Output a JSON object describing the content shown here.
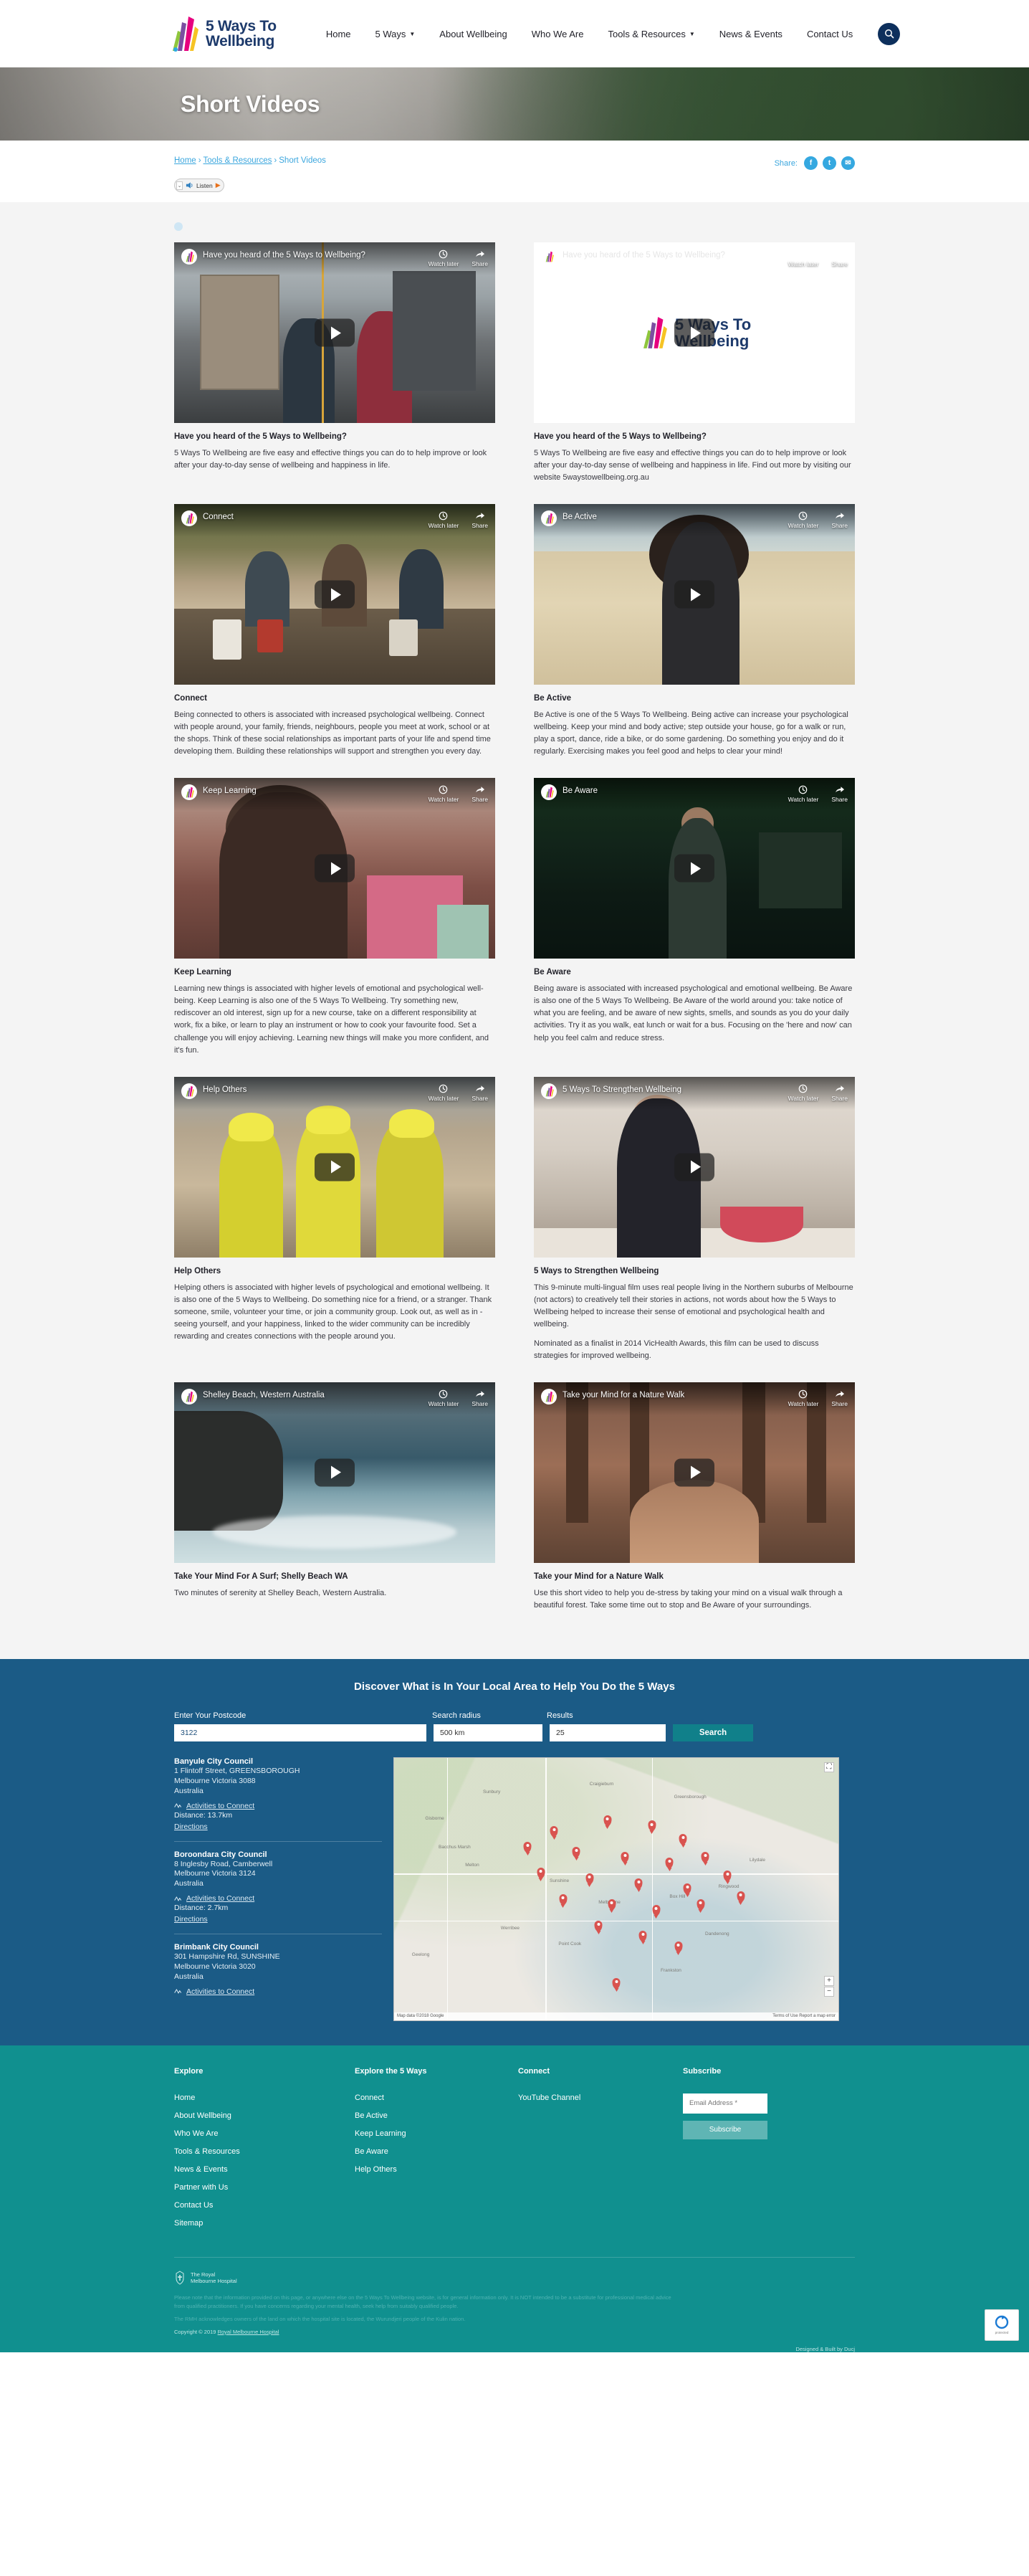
{
  "site": {
    "logo_line1": "5 Ways To",
    "logo_line2": "Wellbeing"
  },
  "nav": {
    "items": [
      {
        "label": "Home",
        "has_dropdown": false
      },
      {
        "label": "5 Ways",
        "has_dropdown": true
      },
      {
        "label": "About Wellbeing",
        "has_dropdown": false
      },
      {
        "label": "Who We Are",
        "has_dropdown": false
      },
      {
        "label": "Tools & Resources",
        "has_dropdown": true
      },
      {
        "label": "News & Events",
        "has_dropdown": false
      },
      {
        "label": "Contact Us",
        "has_dropdown": false
      }
    ],
    "search_icon": "search-icon"
  },
  "hero": {
    "title": "Short Videos"
  },
  "breadcrumb": {
    "items": [
      "Home",
      "Tools & Resources",
      "Short Videos"
    ],
    "separator": "›"
  },
  "share": {
    "label": "Share:",
    "icons": [
      {
        "name": "facebook-icon",
        "glyph": "f"
      },
      {
        "name": "twitter-icon",
        "glyph": "t"
      },
      {
        "name": "email-icon",
        "glyph": "✉"
      }
    ]
  },
  "listen_widget": {
    "label": "Listen",
    "play_glyph": "▶",
    "chevron": "⌄"
  },
  "videos": [
    {
      "overlay_title": "Have you heard of the 5 Ways to Wellbeing?",
      "watch_later": "Watch later",
      "share": "Share",
      "title": "Have you heard of the 5 Ways to Wellbeing?",
      "paragraphs": [
        "5 Ways To Wellbeing are five easy and effective things you can do to help improve or look after your day-to-day sense of wellbeing and happiness in life."
      ],
      "scene": "s-tram",
      "bar_style": "dark"
    },
    {
      "overlay_title": "Have you heard of the 5 Ways to Wellbeing?",
      "watch_later": "Watch later",
      "share": "Share",
      "title": "Have you heard of the 5 Ways to Wellbeing?",
      "paragraphs": [
        "5 Ways To Wellbeing are five easy and effective things you can do to help improve or look after your day-to-day sense of wellbeing and happiness in life. Find out more by visiting our website 5waystowellbeing.org.au"
      ],
      "scene": "s-white",
      "bar_style": "light"
    },
    {
      "overlay_title": "Connect",
      "watch_later": "Watch later",
      "share": "Share",
      "title": "Connect",
      "paragraphs": [
        "Being connected to others is associated with increased psychological wellbeing. Connect with people around, your family, friends, neighbours, people you meet at work, school or at the shops. Think of these social relationships as important parts of your life and spend time developing them. Building these relationships will support and strengthen you every day."
      ],
      "scene": "s-table",
      "bar_style": "dark"
    },
    {
      "overlay_title": "Be Active",
      "watch_later": "Watch later",
      "share": "Share",
      "title": "Be Active",
      "paragraphs": [
        "Be Active is one of the 5 Ways To Wellbeing. Being active can increase your psychological wellbeing. Keep your mind and body active; step outside your house, go for a walk or run, play a sport, dance, ride a bike, or do some gardening. Do something you enjoy and do it regularly. Exercising makes you feel good and helps to clear your mind!"
      ],
      "scene": "s-beach",
      "bar_style": "dark"
    },
    {
      "overlay_title": "Keep Learning",
      "watch_later": "Watch later",
      "share": "Share",
      "title": "Keep Learning",
      "paragraphs": [
        "Learning new things is associated with higher levels of emotional and psychological well-being. Keep Learning is also one of the 5 Ways To Wellbeing. Try something new, rediscover an old interest, sign up for a new course, take on a different responsibility at work, fix a bike, or learn to play an instrument or how to cook your favourite food. Set a challenge you will enjoy achieving. Learning new things will make you more confident, and it's fun."
      ],
      "scene": "s-kitchen",
      "bar_style": "dark"
    },
    {
      "overlay_title": "Be Aware",
      "watch_later": "Watch later",
      "share": "Share",
      "title": "Be Aware",
      "paragraphs": [
        "Being aware is associated with increased psychological and emotional wellbeing. Be Aware is also one of the 5 Ways To Wellbeing. Be Aware of the world around you: take notice of what you are feeling, and be aware of new sights, smells, and sounds as you do your daily activities. Try it as you walk, eat lunch or wait for a bus. Focusing on the 'here and now' can help you feel calm and reduce stress."
      ],
      "scene": "s-night",
      "bar_style": "dark"
    },
    {
      "overlay_title": "Help Others",
      "watch_later": "Watch later",
      "share": "Share",
      "title": "Help Others",
      "paragraphs": [
        "Helping others is associated with higher levels of psychological and emotional wellbeing. It is also one of the 5 Ways to Wellbeing. Do something nice for a friend, or a stranger. Thank someone, smile, volunteer your time, or join a community group. Look out, as well as in - seeing yourself, and your happiness, linked to the wider community can be incredibly rewarding and creates connections with the people around you."
      ],
      "scene": "s-site",
      "bar_style": "dark"
    },
    {
      "overlay_title": "5 Ways To Strengthen Wellbeing",
      "watch_later": "Watch later",
      "share": "Share",
      "title": "5 Ways to Strengthen Wellbeing",
      "paragraphs": [
        "This 9-minute multi-lingual film uses real people living in the Northern suburbs of Melbourne (not actors) to creatively tell their stories in actions, not words about how the 5 Ways to Wellbeing helped to increase their sense of emotional and psychological health and wellbeing.",
        "Nominated as a finalist in 2014 VicHealth Awards, this film can be used to discuss strategies for improved wellbeing."
      ],
      "scene": "s-cook",
      "bar_style": "dark"
    },
    {
      "overlay_title": "Shelley Beach, Western Australia",
      "watch_later": "Watch later",
      "share": "Share",
      "title": "Take Your Mind For A Surf; Shelly Beach WA",
      "paragraphs": [
        "Two minutes of serenity at Shelley Beach, Western Australia."
      ],
      "scene": "s-ocean",
      "bar_style": "dark"
    },
    {
      "overlay_title": "Take your Mind for a Nature Walk",
      "watch_later": "Watch later",
      "share": "Share",
      "title": "Take your Mind for a Nature Walk",
      "paragraphs": [
        "Use this short video to help you de-stress by taking your mind on a visual walk through a beautiful forest. Take some time out to stop and Be Aware of your surroundings."
      ],
      "scene": "s-forest",
      "bar_style": "dark"
    }
  ],
  "locator": {
    "heading": "Discover What is In Your Local Area to Help You Do the 5 Ways",
    "label_postcode": "Enter Your Postcode",
    "label_radius": "Search radius",
    "label_results": "Results",
    "postcode_value": "3122",
    "radius_value": "500 km",
    "results_value": "25",
    "search_button": "Search",
    "results_list": [
      {
        "name": "Banyule City Council",
        "address1": "1 Flintoff Street, GREENSBOROUGH",
        "address2": "Melbourne Victoria 3088",
        "address3": "Australia",
        "activities_link": "Activities to Connect",
        "distance": "Distance: 13.7km",
        "directions": "Directions"
      },
      {
        "name": "Boroondara City Council",
        "address1": "8 Inglesby Road, Camberwell",
        "address2": "Melbourne Victoria 3124",
        "address3": "Australia",
        "activities_link": "Activities to Connect",
        "distance": "Distance: 2.7km",
        "directions": "Directions"
      },
      {
        "name": "Brimbank City Council",
        "address1": "301 Hampshire Rd, SUNSHINE",
        "address2": "Melbourne Victoria 3020",
        "address3": "Australia",
        "activities_link": "Activities to Connect",
        "distance": "",
        "directions": ""
      }
    ],
    "map": {
      "labels": [
        "Sunbury",
        "Gisborne",
        "Craigieburn",
        "Greensborough",
        "Melton",
        "Sunshine",
        "Melbourne",
        "Ringwood",
        "Box Hill",
        "Werribee",
        "Point Cook",
        "Frankston",
        "Dandenong",
        "Geelong",
        "Bacchus Marsh",
        "Lilydale"
      ],
      "attribution_left": "Map data ©2018 Google",
      "attribution_right": "Terms of Use   Report a map error",
      "zoom_in": "+",
      "zoom_out": "−",
      "fullscreen": "⛶"
    }
  },
  "footer": {
    "columns": [
      {
        "heading": "Explore",
        "links": [
          "Home",
          "About Wellbeing",
          "Who We Are",
          "Tools & Resources",
          "News & Events",
          "Partner with Us",
          "Contact Us",
          "Sitemap"
        ]
      },
      {
        "heading": "Explore the 5 Ways",
        "links": [
          "Connect",
          "Be Active",
          "Keep Learning",
          "Be Aware",
          "Help Others"
        ]
      },
      {
        "heading": "Connect",
        "links": [
          "YouTube Channel"
        ]
      }
    ],
    "subscribe": {
      "heading": "Subscribe",
      "placeholder": "Email Address *",
      "button": "Subscribe"
    },
    "rmh_line1": "The Royal",
    "rmh_line2": "Melbourne Hospital",
    "disclaimer": [
      "Please note that the information provided on this page, or anywhere else on the 5 Ways To Wellbeing website, is for general information only. It is NOT intended to be a substitute for professional medical advice from qualified practitioners. If you have concerns regarding your mental health, seek help from suitably qualified people.",
      "The RMH acknowledges owners of the land on which the hospital site is located, the Wurundjeri people of the Kulin nation."
    ],
    "copyright_prefix": "Copyright © 2019",
    "copyright_link": "Royal Melbourne Hospital",
    "built_by": "Designed & Built by Ducj"
  },
  "colors": {
    "brand_navy": "#1d3a6b",
    "link_blue": "#3aa6de",
    "locator_bg": "#1b5b86",
    "footer_teal": "#10908f",
    "search_teal": "#10808a",
    "pin_red": "#d9534f"
  }
}
